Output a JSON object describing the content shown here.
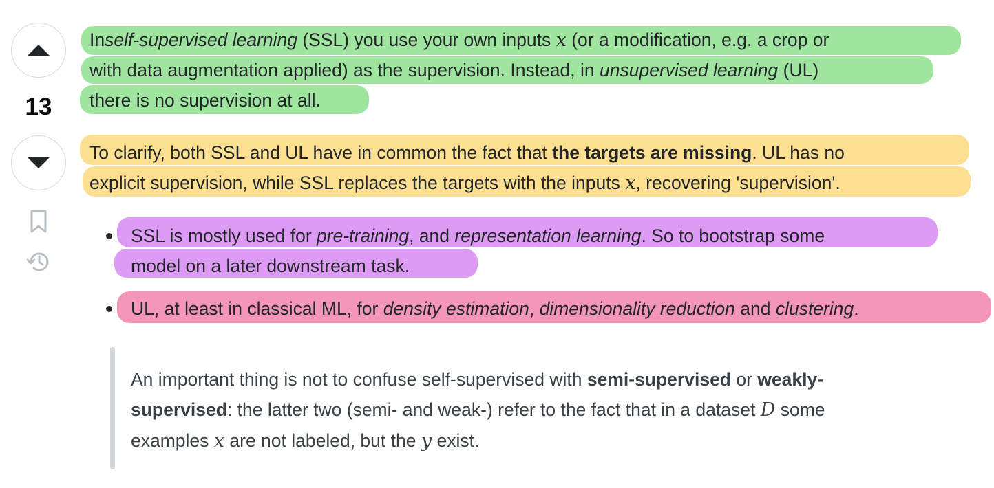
{
  "vote": {
    "count": "13"
  },
  "icons": {
    "upvote": "upvote-arrow-icon",
    "downvote": "downvote-arrow-icon",
    "bookmark": "bookmark-icon",
    "history": "history-icon"
  },
  "highlights": {
    "green": "#8ee08e",
    "yellow": "#fcd97c",
    "purple": "#d889f5",
    "pink": "#f184ab"
  },
  "paragraph1": {
    "l1_a": "In",
    "l1_b": "self-supervised learning",
    "l1_c": " (SSL) you use your own inputs ",
    "l1_x": "x",
    "l1_d": "  (or a modification, e.g. a crop or",
    "l2_a": "with data augmentation applied) as the supervision. Instead, in ",
    "l2_b": "unsupervised learning",
    "l2_c": " (UL)",
    "l3": "there is no supervision at all."
  },
  "paragraph2": {
    "l1_a": "To clarify, both SSL and UL have in common the fact that ",
    "l1_b": "the targets are missing",
    "l1_c": ". UL has no",
    "l2_a": "explicit supervision, while SSL replaces the targets with the inputs ",
    "l2_x": "x",
    "l2_b": ", recovering 'supervision'."
  },
  "bullets": {
    "b1_a": "SSL is mostly used for ",
    "b1_b": "pre-training",
    "b1_c": ", and ",
    "b1_d": "representation learning",
    "b1_e": ". So to bootstrap some",
    "b1_f": "model on a later downstream task.",
    "b2_a": "UL, at least in classical ML, for ",
    "b2_b": "density estimation",
    "b2_c": ", ",
    "b2_d": "dimensionality reduction",
    "b2_e": " and ",
    "b2_f": "clustering",
    "b2_g": "."
  },
  "quote": {
    "l1_a": "An important thing is not to confuse self-supervised with ",
    "l1_b": "semi-supervised",
    "l1_c": " or ",
    "l1_d": "weakly-",
    "l2_a": "supervised",
    "l2_b": ": the latter two (semi- and weak-) refer to the fact that in a dataset ",
    "l2_D": "D",
    "l2_c": " some",
    "l3_a": "examples ",
    "l3_x": "x",
    "l3_b": " are not labeled, but the ",
    "l3_y": "y",
    "l3_c": " exist."
  }
}
